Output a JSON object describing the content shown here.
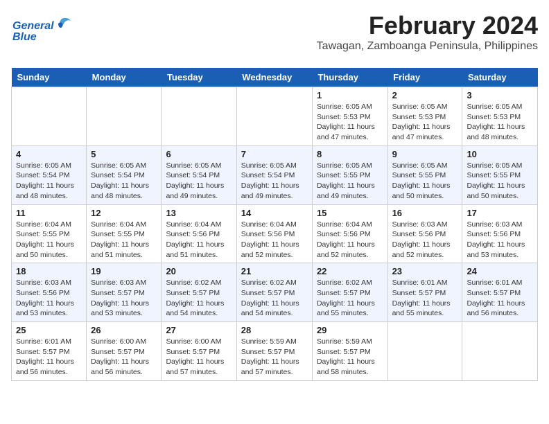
{
  "header": {
    "title": "February 2024",
    "subtitle": "Tawagan, Zamboanga Peninsula, Philippines"
  },
  "logo": {
    "text_general": "General",
    "text_blue": "Blue"
  },
  "columns": [
    "Sunday",
    "Monday",
    "Tuesday",
    "Wednesday",
    "Thursday",
    "Friday",
    "Saturday"
  ],
  "weeks": [
    [
      {
        "day": "",
        "sunrise": "",
        "sunset": "",
        "daylight": ""
      },
      {
        "day": "",
        "sunrise": "",
        "sunset": "",
        "daylight": ""
      },
      {
        "day": "",
        "sunrise": "",
        "sunset": "",
        "daylight": ""
      },
      {
        "day": "",
        "sunrise": "",
        "sunset": "",
        "daylight": ""
      },
      {
        "day": "1",
        "sunrise": "Sunrise: 6:05 AM",
        "sunset": "Sunset: 5:53 PM",
        "daylight": "Daylight: 11 hours and 47 minutes."
      },
      {
        "day": "2",
        "sunrise": "Sunrise: 6:05 AM",
        "sunset": "Sunset: 5:53 PM",
        "daylight": "Daylight: 11 hours and 47 minutes."
      },
      {
        "day": "3",
        "sunrise": "Sunrise: 6:05 AM",
        "sunset": "Sunset: 5:53 PM",
        "daylight": "Daylight: 11 hours and 48 minutes."
      }
    ],
    [
      {
        "day": "4",
        "sunrise": "Sunrise: 6:05 AM",
        "sunset": "Sunset: 5:54 PM",
        "daylight": "Daylight: 11 hours and 48 minutes."
      },
      {
        "day": "5",
        "sunrise": "Sunrise: 6:05 AM",
        "sunset": "Sunset: 5:54 PM",
        "daylight": "Daylight: 11 hours and 48 minutes."
      },
      {
        "day": "6",
        "sunrise": "Sunrise: 6:05 AM",
        "sunset": "Sunset: 5:54 PM",
        "daylight": "Daylight: 11 hours and 49 minutes."
      },
      {
        "day": "7",
        "sunrise": "Sunrise: 6:05 AM",
        "sunset": "Sunset: 5:54 PM",
        "daylight": "Daylight: 11 hours and 49 minutes."
      },
      {
        "day": "8",
        "sunrise": "Sunrise: 6:05 AM",
        "sunset": "Sunset: 5:55 PM",
        "daylight": "Daylight: 11 hours and 49 minutes."
      },
      {
        "day": "9",
        "sunrise": "Sunrise: 6:05 AM",
        "sunset": "Sunset: 5:55 PM",
        "daylight": "Daylight: 11 hours and 50 minutes."
      },
      {
        "day": "10",
        "sunrise": "Sunrise: 6:05 AM",
        "sunset": "Sunset: 5:55 PM",
        "daylight": "Daylight: 11 hours and 50 minutes."
      }
    ],
    [
      {
        "day": "11",
        "sunrise": "Sunrise: 6:04 AM",
        "sunset": "Sunset: 5:55 PM",
        "daylight": "Daylight: 11 hours and 50 minutes."
      },
      {
        "day": "12",
        "sunrise": "Sunrise: 6:04 AM",
        "sunset": "Sunset: 5:55 PM",
        "daylight": "Daylight: 11 hours and 51 minutes."
      },
      {
        "day": "13",
        "sunrise": "Sunrise: 6:04 AM",
        "sunset": "Sunset: 5:56 PM",
        "daylight": "Daylight: 11 hours and 51 minutes."
      },
      {
        "day": "14",
        "sunrise": "Sunrise: 6:04 AM",
        "sunset": "Sunset: 5:56 PM",
        "daylight": "Daylight: 11 hours and 52 minutes."
      },
      {
        "day": "15",
        "sunrise": "Sunrise: 6:04 AM",
        "sunset": "Sunset: 5:56 PM",
        "daylight": "Daylight: 11 hours and 52 minutes."
      },
      {
        "day": "16",
        "sunrise": "Sunrise: 6:03 AM",
        "sunset": "Sunset: 5:56 PM",
        "daylight": "Daylight: 11 hours and 52 minutes."
      },
      {
        "day": "17",
        "sunrise": "Sunrise: 6:03 AM",
        "sunset": "Sunset: 5:56 PM",
        "daylight": "Daylight: 11 hours and 53 minutes."
      }
    ],
    [
      {
        "day": "18",
        "sunrise": "Sunrise: 6:03 AM",
        "sunset": "Sunset: 5:56 PM",
        "daylight": "Daylight: 11 hours and 53 minutes."
      },
      {
        "day": "19",
        "sunrise": "Sunrise: 6:03 AM",
        "sunset": "Sunset: 5:57 PM",
        "daylight": "Daylight: 11 hours and 53 minutes."
      },
      {
        "day": "20",
        "sunrise": "Sunrise: 6:02 AM",
        "sunset": "Sunset: 5:57 PM",
        "daylight": "Daylight: 11 hours and 54 minutes."
      },
      {
        "day": "21",
        "sunrise": "Sunrise: 6:02 AM",
        "sunset": "Sunset: 5:57 PM",
        "daylight": "Daylight: 11 hours and 54 minutes."
      },
      {
        "day": "22",
        "sunrise": "Sunrise: 6:02 AM",
        "sunset": "Sunset: 5:57 PM",
        "daylight": "Daylight: 11 hours and 55 minutes."
      },
      {
        "day": "23",
        "sunrise": "Sunrise: 6:01 AM",
        "sunset": "Sunset: 5:57 PM",
        "daylight": "Daylight: 11 hours and 55 minutes."
      },
      {
        "day": "24",
        "sunrise": "Sunrise: 6:01 AM",
        "sunset": "Sunset: 5:57 PM",
        "daylight": "Daylight: 11 hours and 56 minutes."
      }
    ],
    [
      {
        "day": "25",
        "sunrise": "Sunrise: 6:01 AM",
        "sunset": "Sunset: 5:57 PM",
        "daylight": "Daylight: 11 hours and 56 minutes."
      },
      {
        "day": "26",
        "sunrise": "Sunrise: 6:00 AM",
        "sunset": "Sunset: 5:57 PM",
        "daylight": "Daylight: 11 hours and 56 minutes."
      },
      {
        "day": "27",
        "sunrise": "Sunrise: 6:00 AM",
        "sunset": "Sunset: 5:57 PM",
        "daylight": "Daylight: 11 hours and 57 minutes."
      },
      {
        "day": "28",
        "sunrise": "Sunrise: 5:59 AM",
        "sunset": "Sunset: 5:57 PM",
        "daylight": "Daylight: 11 hours and 57 minutes."
      },
      {
        "day": "29",
        "sunrise": "Sunrise: 5:59 AM",
        "sunset": "Sunset: 5:57 PM",
        "daylight": "Daylight: 11 hours and 58 minutes."
      },
      {
        "day": "",
        "sunrise": "",
        "sunset": "",
        "daylight": ""
      },
      {
        "day": "",
        "sunrise": "",
        "sunset": "",
        "daylight": ""
      }
    ]
  ]
}
